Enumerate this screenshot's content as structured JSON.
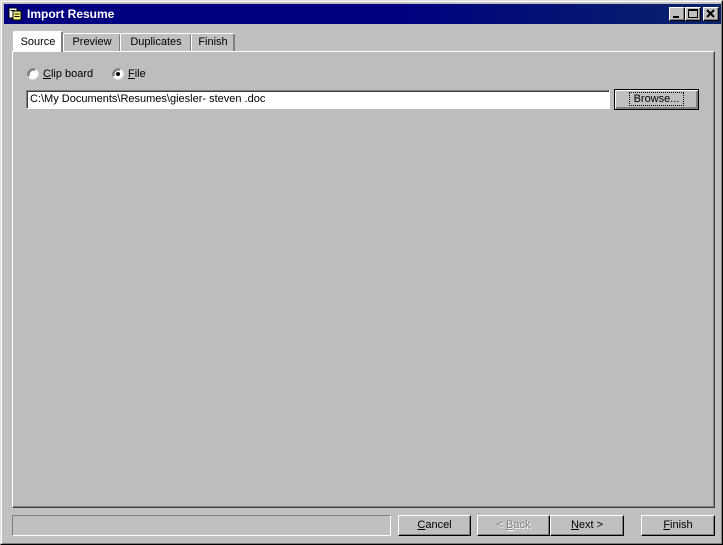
{
  "window": {
    "title": "Import Resume",
    "icon": "import-resume-app-icon",
    "caption_buttons": [
      "minimize-icon",
      "maximize-icon",
      "close-icon"
    ]
  },
  "tabs": [
    {
      "label": "Source",
      "active": true
    },
    {
      "label": "Preview",
      "active": false
    },
    {
      "label": "Duplicates",
      "active": false
    },
    {
      "label": "Finish",
      "active": false
    }
  ],
  "source": {
    "radio_clipboard": {
      "label_hotkey": "C",
      "label_rest": "lip board",
      "checked": false
    },
    "radio_file": {
      "label_hotkey": "F",
      "label_rest": "ile",
      "checked": true
    },
    "file_path": "C:\\My Documents\\Resumes\\giesler- steven .doc",
    "browse_label": "Browse..."
  },
  "footer": {
    "status_text": "",
    "cancel": {
      "hotkey": "C",
      "rest": "ancel"
    },
    "back": {
      "pre": "< ",
      "hotkey": "B",
      "rest": "ack",
      "enabled": false
    },
    "next": {
      "hotkey": "N",
      "rest": "ext >"
    },
    "finish": {
      "hotkey": "F",
      "rest": "inish"
    }
  }
}
